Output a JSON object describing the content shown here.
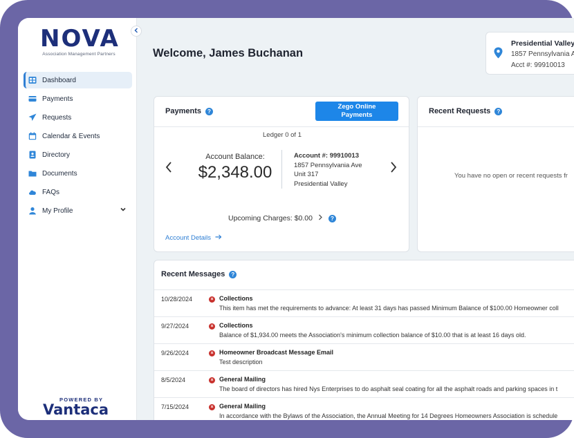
{
  "brand": {
    "name": "NOVA",
    "tagline": "Association Management Partners",
    "powered_by": "POWERED BY",
    "powered_brand": "Vantaca",
    "accent": "#1d2f7a"
  },
  "sidebar": {
    "items": [
      {
        "label": "Dashboard",
        "icon": "dashboard-icon",
        "active": true
      },
      {
        "label": "Payments",
        "icon": "credit-card-icon"
      },
      {
        "label": "Requests",
        "icon": "paper-plane-icon"
      },
      {
        "label": "Calendar & Events",
        "icon": "calendar-icon"
      },
      {
        "label": "Directory",
        "icon": "address-book-icon"
      },
      {
        "label": "Documents",
        "icon": "folder-icon"
      },
      {
        "label": "FAQs",
        "icon": "cloud-icon"
      },
      {
        "label": "My Profile",
        "icon": "user-icon"
      }
    ]
  },
  "header": {
    "welcome": "Welcome, James Buchanan"
  },
  "property": {
    "name": "Presidential Valley",
    "address": "1857 Pennsylvania A",
    "account": "Acct #: 99910013"
  },
  "payments": {
    "title": "Payments",
    "zego_line1": "Zego Online",
    "zego_line2": "Payments",
    "ledger": "Ledger 0 of 1",
    "balance_label": "Account Balance:",
    "balance_value": "$2,348.00",
    "account_number": "Account #: 99910013",
    "address_line1": "1857 Pennsylvania Ave",
    "address_line2": "Unit 317",
    "address_line3": "Presidential Valley",
    "upcoming": "Upcoming Charges: $0.00",
    "account_details": "Account Details"
  },
  "requests": {
    "title": "Recent Requests",
    "empty": "You have no open or recent requests fr"
  },
  "messages": {
    "title": "Recent Messages",
    "items": [
      {
        "date": "10/28/2024",
        "title": "Collections",
        "body": "This item has met the requirements to advance: At least 31 days has passed Minimum Balance of $100.00 Homeowner coll"
      },
      {
        "date": "9/27/2024",
        "title": "Collections",
        "body": "Balance of $1,934.00 meets the Association's minimum collection balance of $10.00 that is at least 16 days old."
      },
      {
        "date": "9/26/2024",
        "title": "Homeowner Broadcast Message Email",
        "body": "Test description"
      },
      {
        "date": "8/5/2024",
        "title": "General Mailing",
        "body": "The board of directors has hired Nys Enterprises to do asphalt seal coating for all the asphalt roads and parking spaces in t"
      },
      {
        "date": "7/15/2024",
        "title": "General Mailing",
        "body": "In accordance with the Bylaws of the Association, the Annual Meeting for 14 Degrees Homeowners Association is schedule"
      }
    ]
  }
}
